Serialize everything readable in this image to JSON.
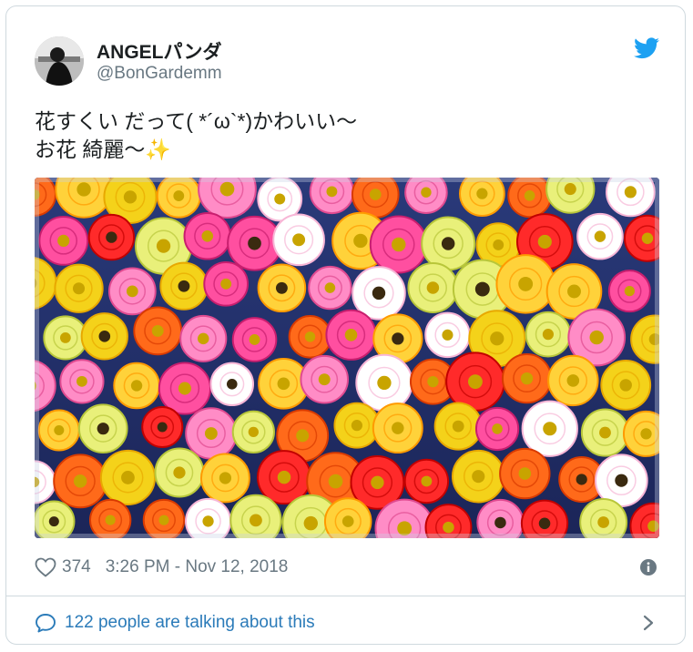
{
  "tweet": {
    "display_name": "ANGELパンダ",
    "handle": "@BonGardemm",
    "text_line1": "花すくい だって( *´ω`*)かわいい〜",
    "text_line2": "お花 綺麗〜✨",
    "likes": "374",
    "timestamp": "3:26 PM - Nov 12, 2018"
  },
  "footer": {
    "conversation_label": "122 people are talking about this"
  },
  "icons": {
    "brand": "twitter-bird-icon",
    "like": "heart-icon",
    "info": "info-icon",
    "reply": "speech-bubble-icon",
    "more": "chevron-right-icon"
  },
  "colors": {
    "accent": "#1da1f2",
    "link": "#2b7bb9",
    "secondary_text": "#697882",
    "border": "#cfd9de"
  }
}
